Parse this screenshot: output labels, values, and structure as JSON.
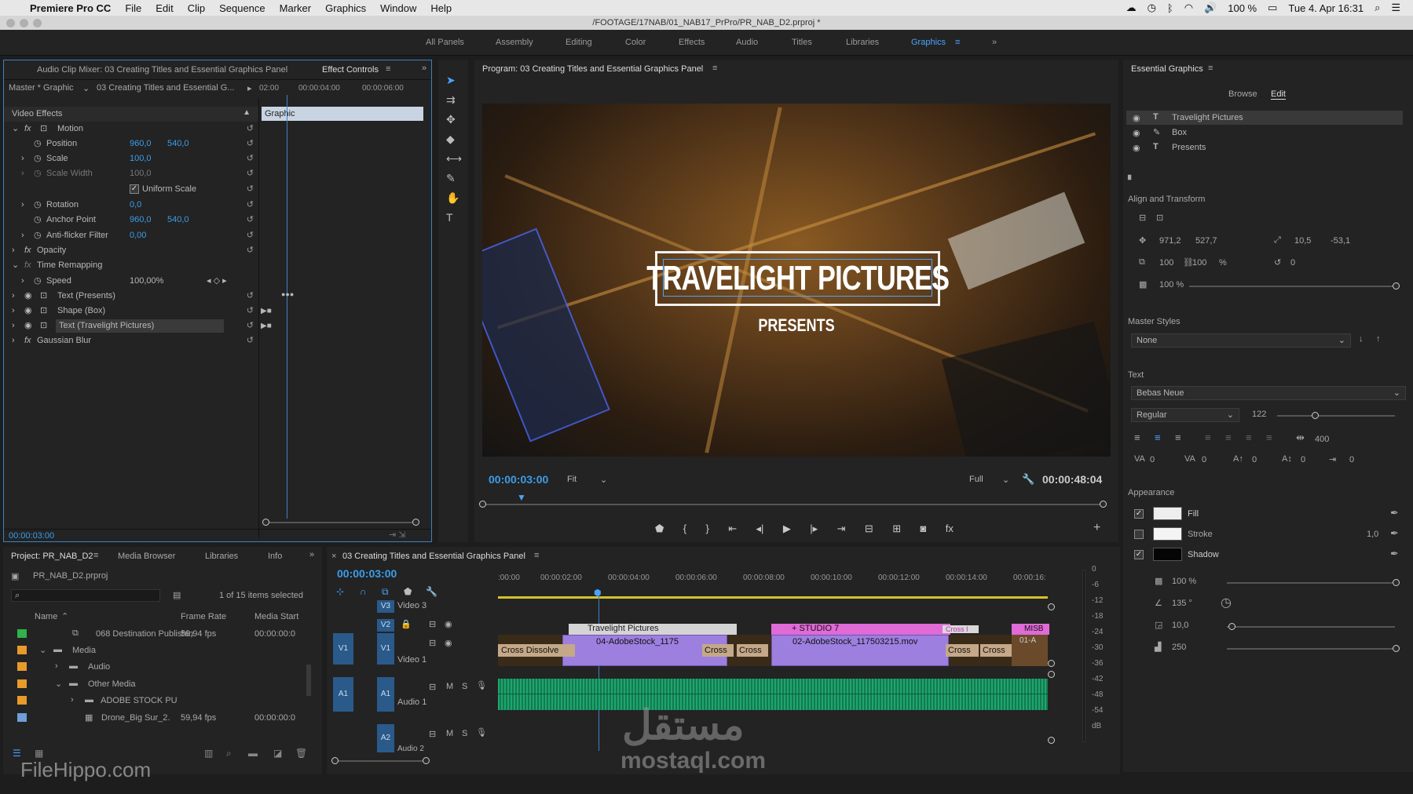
{
  "menubar": {
    "app": "Premiere Pro CC",
    "items": [
      "File",
      "Edit",
      "Clip",
      "Sequence",
      "Marker",
      "Graphics",
      "Window",
      "Help"
    ],
    "battery": "100 %",
    "datetime": "Tue 4. Apr  16:31"
  },
  "window_title": "/FOOTAGE/17NAB/01_NAB17_PrPro/PR_NAB_D2.prproj *",
  "workspaces": [
    "All Panels",
    "Assembly",
    "Editing",
    "Color",
    "Effects",
    "Audio",
    "Titles",
    "Libraries",
    "Graphics"
  ],
  "effect_controls": {
    "tab_mixer": "Audio Clip Mixer: 03 Creating Titles and Essential Graphics Panel",
    "tab_active": "Effect Controls",
    "master": "Master * Graphic",
    "sequence": "03 Creating Titles and Essential G...",
    "ruler": [
      "02:00",
      "00:00:04:00",
      "00:00:06:00"
    ],
    "clip_label": "Graphic",
    "video_effects": "Video Effects",
    "motion": "Motion",
    "position_label": "Position",
    "position_x": "960,0",
    "position_y": "540,0",
    "scale_label": "Scale",
    "scale": "100,0",
    "scale_width_label": "Scale Width",
    "scale_width": "100,0",
    "uniform_scale": "Uniform Scale",
    "rotation_label": "Rotation",
    "rotation": "0,0",
    "anchor_label": "Anchor Point",
    "anchor_x": "960,0",
    "anchor_y": "540,0",
    "antiflicker_label": "Anti-flicker Filter",
    "antiflicker": "0,00",
    "opacity": "Opacity",
    "time_remap": "Time Remapping",
    "speed_label": "Speed",
    "speed": "100,00%",
    "text_presents": "Text (Presents)",
    "shape_box": "Shape (Box)",
    "text_travelight": "Text (Travelight Pictures)",
    "gaussian": "Gaussian Blur",
    "timecode": "00:00:03:00"
  },
  "program": {
    "title": "Program: 03 Creating Titles and Essential Graphics Panel",
    "title_text": "TRAVELIGHT PICTURES",
    "sub_text": "PRESENTS",
    "timecode": "00:00:03:00",
    "fit": "Fit",
    "quality": "Full",
    "duration": "00:00:48:04"
  },
  "essential": {
    "title": "Essential Graphics",
    "tab_browse": "Browse",
    "tab_edit": "Edit",
    "layers": [
      "Travelight Pictures",
      "Box",
      "Presents"
    ],
    "align_title": "Align and Transform",
    "pos_x": "971,2",
    "pos_y": "527,7",
    "anchor_x": "10,5",
    "anchor_y": "-53,1",
    "scale_w": "100",
    "scale_h": "100",
    "scale_unit": "%",
    "rotation": "0",
    "opacity": "100 %",
    "master_styles": "Master Styles",
    "master_value": "None",
    "text_section": "Text",
    "font": "Bebas Neue",
    "style": "Regular",
    "size": "122",
    "tracking_val": "400",
    "kern": [
      "0",
      "0",
      "0",
      "0",
      "0"
    ],
    "appearance": "Appearance",
    "fill": "Fill",
    "stroke": "Stroke",
    "stroke_val": "1,0",
    "shadow": "Shadow",
    "sh_opacity": "100 %",
    "sh_angle": "135 °",
    "sh_distance": "10,0",
    "sh_blur": "250"
  },
  "project": {
    "tabs": [
      "Project: PR_NAB_D2",
      "Media Browser",
      "Libraries",
      "Info"
    ],
    "file": "PR_NAB_D2.prproj",
    "selected": "1 of 15 items selected",
    "cols": [
      "Name",
      "Frame Rate",
      "Media Start"
    ],
    "rows": [
      {
        "name": "068 Destination Publishin",
        "rate": "59,94 fps",
        "start": "00:00:00:0",
        "color": "#2fb34a"
      },
      {
        "name": "Media",
        "rate": "",
        "start": "",
        "color": "#e89a2a"
      },
      {
        "name": "Audio",
        "rate": "",
        "start": "",
        "color": "#e89a2a"
      },
      {
        "name": "Other Media",
        "rate": "",
        "start": "",
        "color": "#e89a2a"
      },
      {
        "name": "ADOBE STOCK PU",
        "rate": "",
        "start": "",
        "color": "#e89a2a"
      },
      {
        "name": "Drone_Big Sur_2.",
        "rate": "59,94 fps",
        "start": "00:00:00:0",
        "color": "#6e9fd8"
      }
    ]
  },
  "timeline": {
    "title": "03 Creating Titles and Essential Graphics Panel",
    "timecode": "00:00:03:00",
    "ruler": [
      ":00:00",
      "00:00:02:00",
      "00:00:04:00",
      "00:00:06:00",
      "00:00:08:00",
      "00:00:10:00",
      "00:00:12:00",
      "00:00:14:00",
      "00:00:16:"
    ],
    "tracks": [
      "Video 3",
      "Video 1",
      "Audio 1",
      "Audio 2"
    ],
    "v1": "V1",
    "v2": "V2",
    "v3": "V3",
    "a1": "A1",
    "a2": "A2",
    "m": "M",
    "s": "S",
    "clips": {
      "travelight": "Travelight Pictures",
      "studio": "+ STUDIO 7",
      "misb": "MISB",
      "cross_a": "Cross I",
      "stock1": "04-AdobeStock_1175",
      "stock2": "02-AdobeStock_117503215.mov",
      "stock3": "01-A",
      "cross_dissolve": "Cross Dissolve",
      "cross_d": "Cross D"
    }
  },
  "meter": [
    "0",
    "-6",
    "-12",
    "-18",
    "-24",
    "-30",
    "-36",
    "-42",
    "-48",
    "-54",
    "dB"
  ],
  "watermark": {
    "site": "mostaql.com",
    "arabic": "مستقل",
    "filehippo": "FileHippo.com"
  }
}
